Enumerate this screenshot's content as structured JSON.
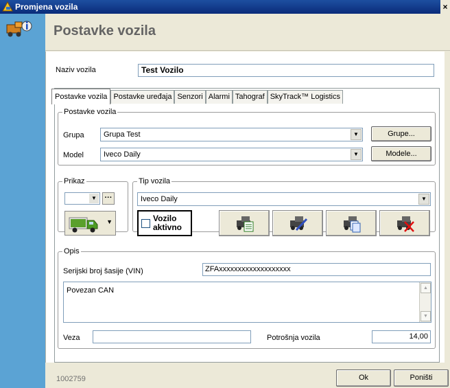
{
  "window": {
    "title": "Promjena vozila",
    "close_glyph": "×"
  },
  "header": {
    "title": "Postavke vozila"
  },
  "name_field": {
    "label": "Naziv vozila",
    "value": "Test Vozilo"
  },
  "tabs": [
    {
      "label": "Postavke vozila",
      "active": true
    },
    {
      "label": "Postavke uređaja"
    },
    {
      "label": "Senzori"
    },
    {
      "label": "Alarmi"
    },
    {
      "label": "Tahograf"
    },
    {
      "label": "SkyTrack™ Logistics"
    }
  ],
  "settings_group": {
    "legend": "Postavke vozila",
    "group_label": "Grupa",
    "group_value": "Grupa Test",
    "group_button": "Grupe...",
    "model_label": "Model",
    "model_value": "Iveco Daily",
    "model_button": "Modele..."
  },
  "display_group": {
    "legend": "Prikaz",
    "dots": "···"
  },
  "type_group": {
    "legend": "Tip vozila",
    "type_value": "Iveco Daily",
    "active_label_line1": "Vozilo",
    "active_label_line2": "aktivno"
  },
  "description_group": {
    "legend": "Opis",
    "vin_label": "Serijski broj šasije (VIN)",
    "vin_value": "ZFAxxxxxxxxxxxxxxxxxxx",
    "note_text": "Povezan CAN",
    "link_label": "Veza",
    "link_value": "",
    "consumption_label": "Potrošnja vozila",
    "consumption_value": "14,00"
  },
  "footer": {
    "id": "1002759",
    "ok_label": "Ok",
    "cancel_label": "Poništi"
  },
  "colors": {
    "titlebar": "#0a2b7a",
    "left_strip": "#5ba3d4",
    "header_text": "#646464"
  }
}
